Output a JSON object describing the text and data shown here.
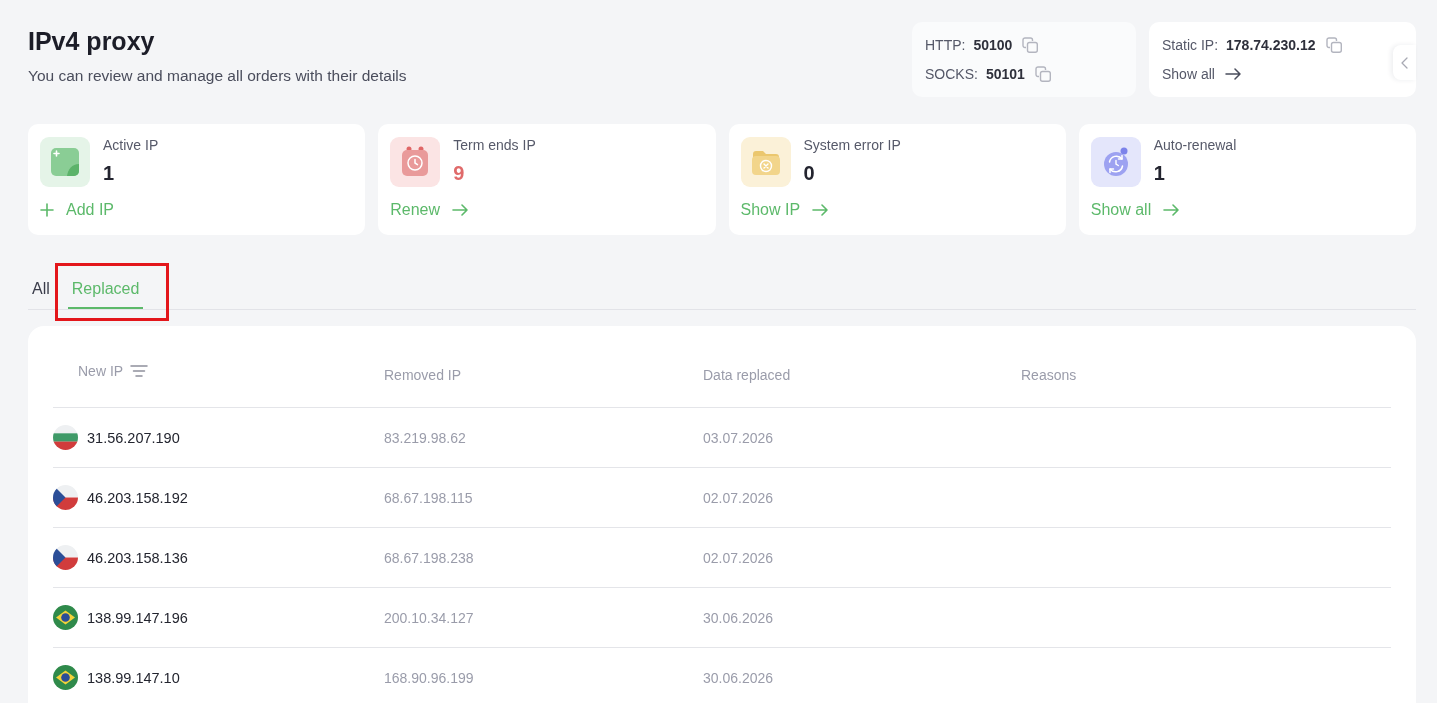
{
  "header": {
    "title": "IPv4 proxy",
    "subtitle": "You can review and manage all orders with their details"
  },
  "ports": [
    {
      "label": "HTTP:",
      "value": "50100"
    },
    {
      "label": "SOCKS:",
      "value": "50101"
    }
  ],
  "static_ip": {
    "label": "Static IP:",
    "value": "178.74.230.12",
    "link": "Show all"
  },
  "stats": [
    {
      "kind": "active",
      "label": "Active IP",
      "value": "1",
      "link": "Add IP"
    },
    {
      "kind": "term",
      "label": "Term ends IP",
      "value": "9",
      "link": "Renew"
    },
    {
      "kind": "error",
      "label": "System error IP",
      "value": "0",
      "link": "Show IP"
    },
    {
      "kind": "auto",
      "label": "Auto-renewal",
      "value": "1",
      "link": "Show all"
    }
  ],
  "tabs": [
    {
      "label": "All",
      "selected": false,
      "highlighted": false
    },
    {
      "label": "Replaced",
      "selected": true,
      "highlighted": true
    }
  ],
  "table": {
    "columns": [
      {
        "label": "New IP",
        "filter": true
      },
      {
        "label": "Removed IP",
        "filter": false
      },
      {
        "label": "Data replaced",
        "filter": false
      },
      {
        "label": "Reasons",
        "filter": false
      }
    ],
    "rows": [
      {
        "kind": "bulgaria",
        "new_ip": "31.56.207.190",
        "removed_ip": "83.219.98.62",
        "date": "03.07.2026"
      },
      {
        "kind": "czechia",
        "new_ip": "46.203.158.192",
        "removed_ip": "68.67.198.115",
        "date": "02.07.2026"
      },
      {
        "kind": "czechia",
        "new_ip": "46.203.158.136",
        "removed_ip": "68.67.198.238",
        "date": "02.07.2026"
      },
      {
        "kind": "brazil",
        "new_ip": "138.99.147.196",
        "removed_ip": "200.10.34.127",
        "date": "30.06.2026"
      },
      {
        "kind": "brazil",
        "new_ip": "138.99.147.10",
        "removed_ip": "168.90.96.199",
        "date": "30.06.2026"
      }
    ]
  }
}
